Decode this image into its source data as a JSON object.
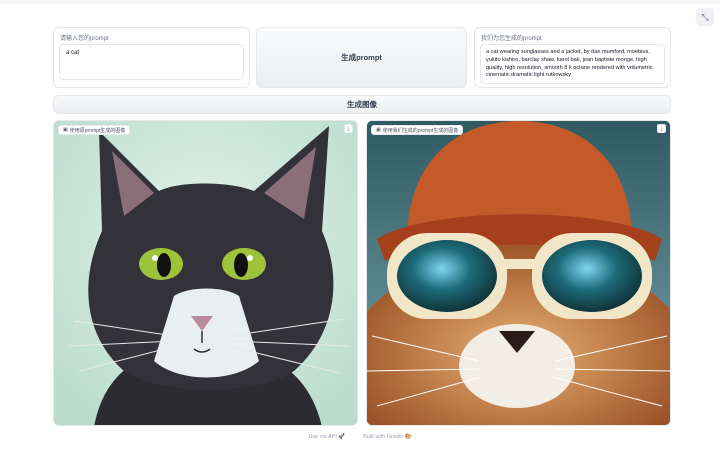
{
  "input": {
    "label": "请输入您的prompt",
    "value": "a cat"
  },
  "buttons": {
    "generate_prompt": "生成prompt",
    "generate_image": "生成图像"
  },
  "output": {
    "label": "我们为您生成的prompt",
    "value": "a cat wearing sunglasses and a jacket, by dan mumford, moebius, yukito kishiro, barclay shaw, karol bak, jean baptiste monge, high quality, high resolution, smooth 8 k octane rendered with volumetric cinematic dramatic light rutkowsky"
  },
  "images": {
    "left_label": "使用原prompt生成的图像",
    "right_label": "使用我们生成的prompt生成的图像",
    "tag_icon": "image-icon",
    "download_icon": "download-icon"
  },
  "footer": {
    "api": "Use via API",
    "api_icon": "🚀",
    "built": "Built with Gradio",
    "built_icon": "🎨",
    "separator": "·"
  },
  "colors": {
    "accent": "#f97316",
    "panel_border": "#e5e7eb",
    "button_bg": "#eceef2"
  }
}
